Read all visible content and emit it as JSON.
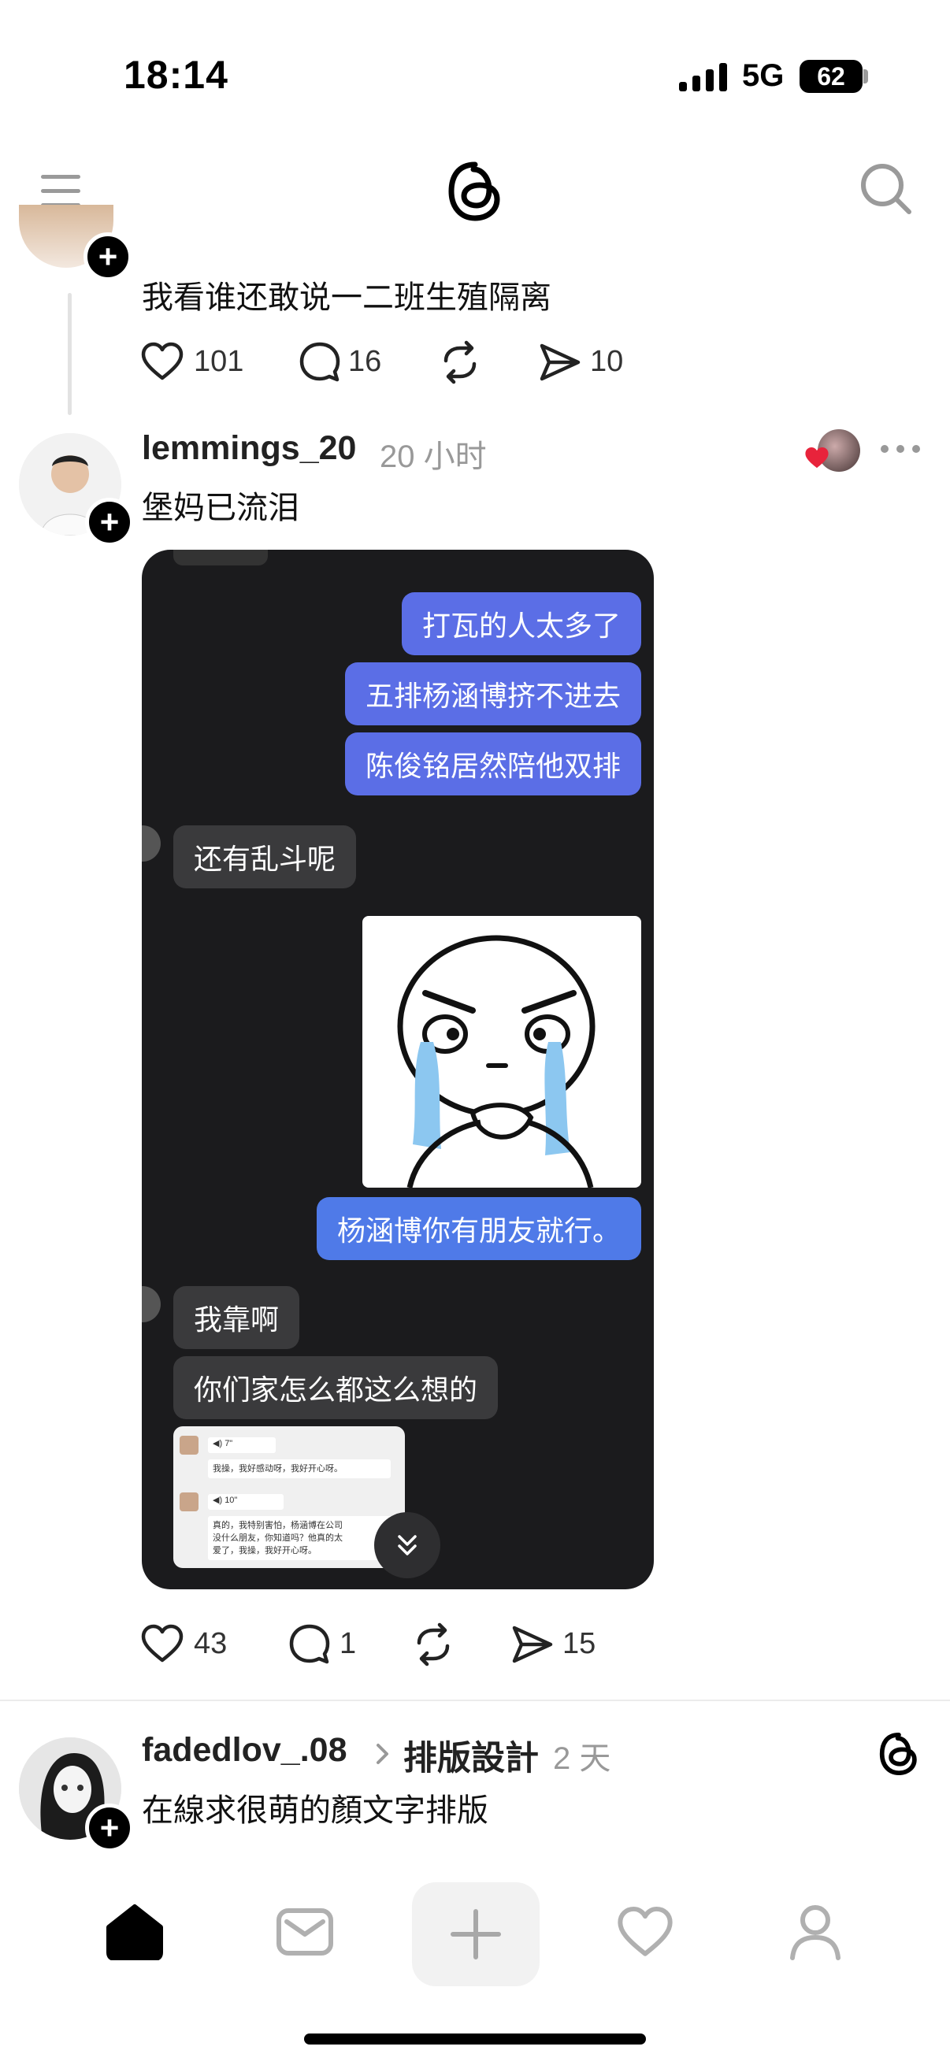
{
  "status_bar": {
    "time": "18:14",
    "network": "5G",
    "battery": "62"
  },
  "nav": {
    "menu_icon": "menu-icon",
    "logo_icon": "threads-logo-icon",
    "search_icon": "search-icon"
  },
  "posts": [
    {
      "text": "我看谁还敢说一二班生殖隔离",
      "likes": "101",
      "comments": "16",
      "shares": "10"
    },
    {
      "username": "lemmings_20",
      "time": "20 小时",
      "text": "堡妈已流泪",
      "likes": "43",
      "comments": "1",
      "shares": "15",
      "chat": {
        "right_1": "打瓦的人太多了",
        "right_2": "五排杨涵博挤不进去",
        "right_3": "陈俊铭居然陪他双排",
        "left_1": "还有乱斗呢",
        "right_4": "杨涵博你有朋友就行。",
        "left_2": "我靠啊",
        "left_3": "你们家怎么都这么想的",
        "thumb": {
          "voice_1": "7\"",
          "line_1": "我操，我好感动呀，我好开心呀。",
          "voice_2": "10\"",
          "line_2a": "真的，我特别害怕，杨涵博在公司",
          "line_2b": "没什么朋友，你知道吗？他真的太",
          "line_2c": "爱了，我操，我好开心呀。"
        }
      }
    },
    {
      "username": "fadedlov_.08",
      "topic": "排版設計",
      "time": "2 天",
      "text": "在線求很萌的顏文字排版"
    }
  ],
  "colors": {
    "accent_blue": "#5b6ee6",
    "bubble_dark": "#3a3a3c",
    "card_bg": "#1b1b1d",
    "like_red": "#e8233b"
  }
}
